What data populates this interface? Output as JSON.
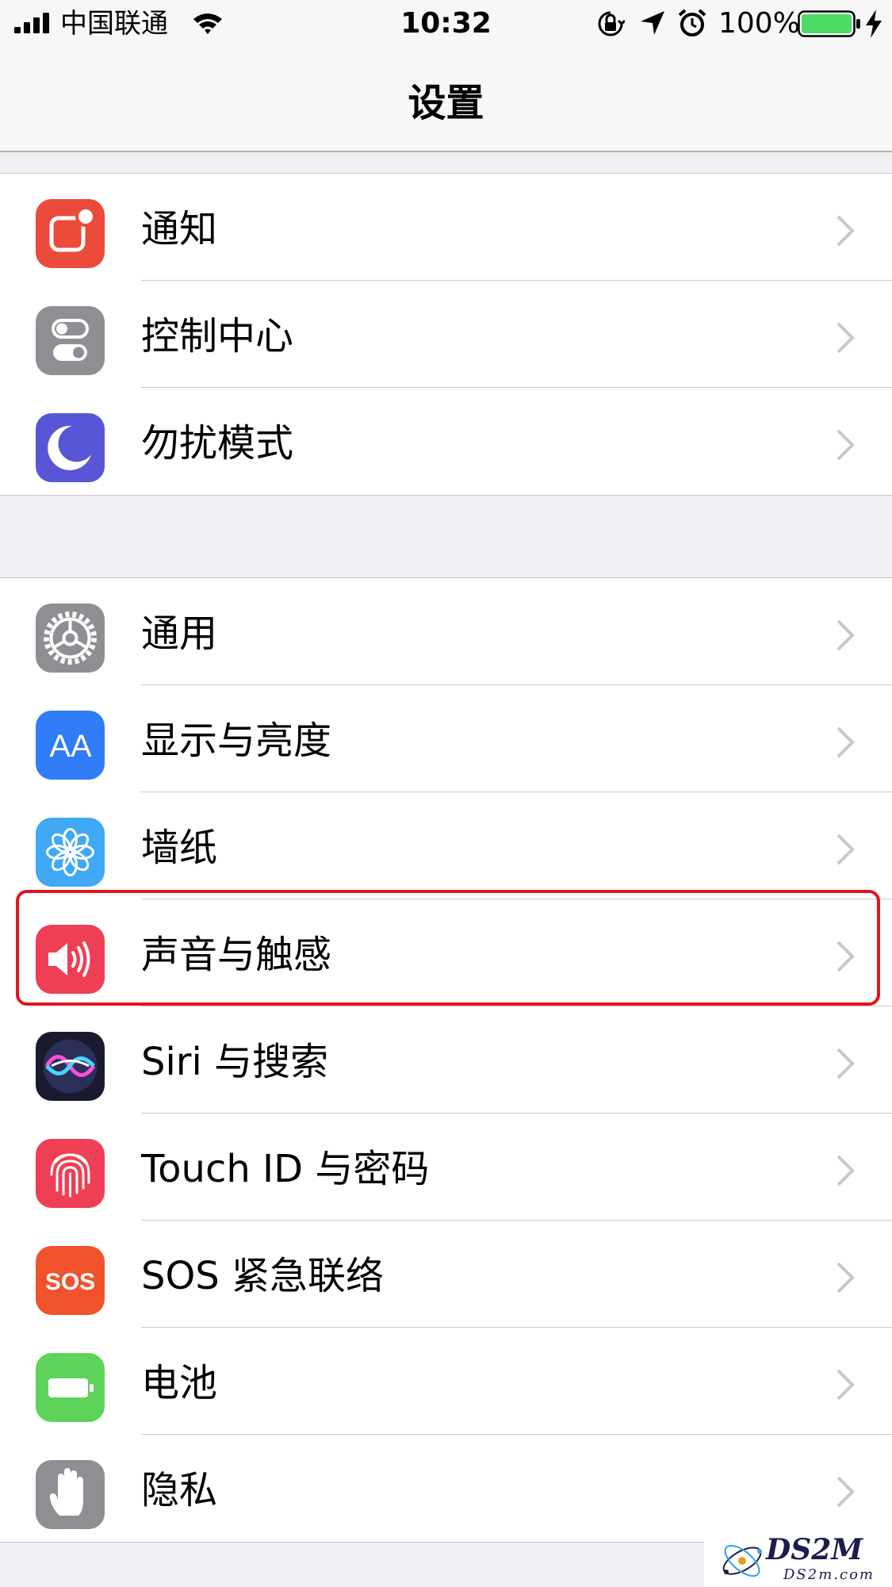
{
  "status_bar": {
    "carrier": "中国联通",
    "time": "10:32",
    "battery_percent": "100%",
    "battery_level": 1.0,
    "charging": true
  },
  "nav": {
    "title": "设置"
  },
  "groups": [
    {
      "items": [
        {
          "label": "通知",
          "icon": "notifications-icon",
          "color": "#ec4a3b"
        },
        {
          "label": "控制中心",
          "icon": "control-center-icon",
          "color": "#8e8e93"
        },
        {
          "label": "勿扰模式",
          "icon": "moon-icon",
          "color": "#5856d6"
        }
      ]
    },
    {
      "items": [
        {
          "label": "通用",
          "icon": "gear-icon",
          "color": "#8e8e93"
        },
        {
          "label": "显示与亮度",
          "icon": "display-brightness-icon",
          "color": "#2f7cf6"
        },
        {
          "label": "墙纸",
          "icon": "wallpaper-flower-icon",
          "color": "#3fa9f5"
        },
        {
          "label": "声音与触感",
          "icon": "speaker-icon",
          "color": "#ee3f55"
        },
        {
          "label": "Siri 与搜索",
          "icon": "siri-icon",
          "color": "#1a1a2e"
        },
        {
          "label": "Touch ID 与密码",
          "icon": "fingerprint-icon",
          "color": "#ee3f55"
        },
        {
          "label": "SOS 紧急联络",
          "icon": "sos-icon",
          "color": "#f0532c"
        },
        {
          "label": "电池",
          "icon": "battery-icon",
          "color": "#5ed35a"
        },
        {
          "label": "隐私",
          "icon": "hand-icon",
          "color": "#8e8e93"
        }
      ]
    }
  ],
  "highlight": {
    "item": "声音与触感",
    "color": "#e3141d"
  },
  "icons": {
    "sos_text": "SOS",
    "display_text": "AA"
  },
  "watermark": {
    "text": "DS2M",
    "subtext": "DS2m.com"
  }
}
